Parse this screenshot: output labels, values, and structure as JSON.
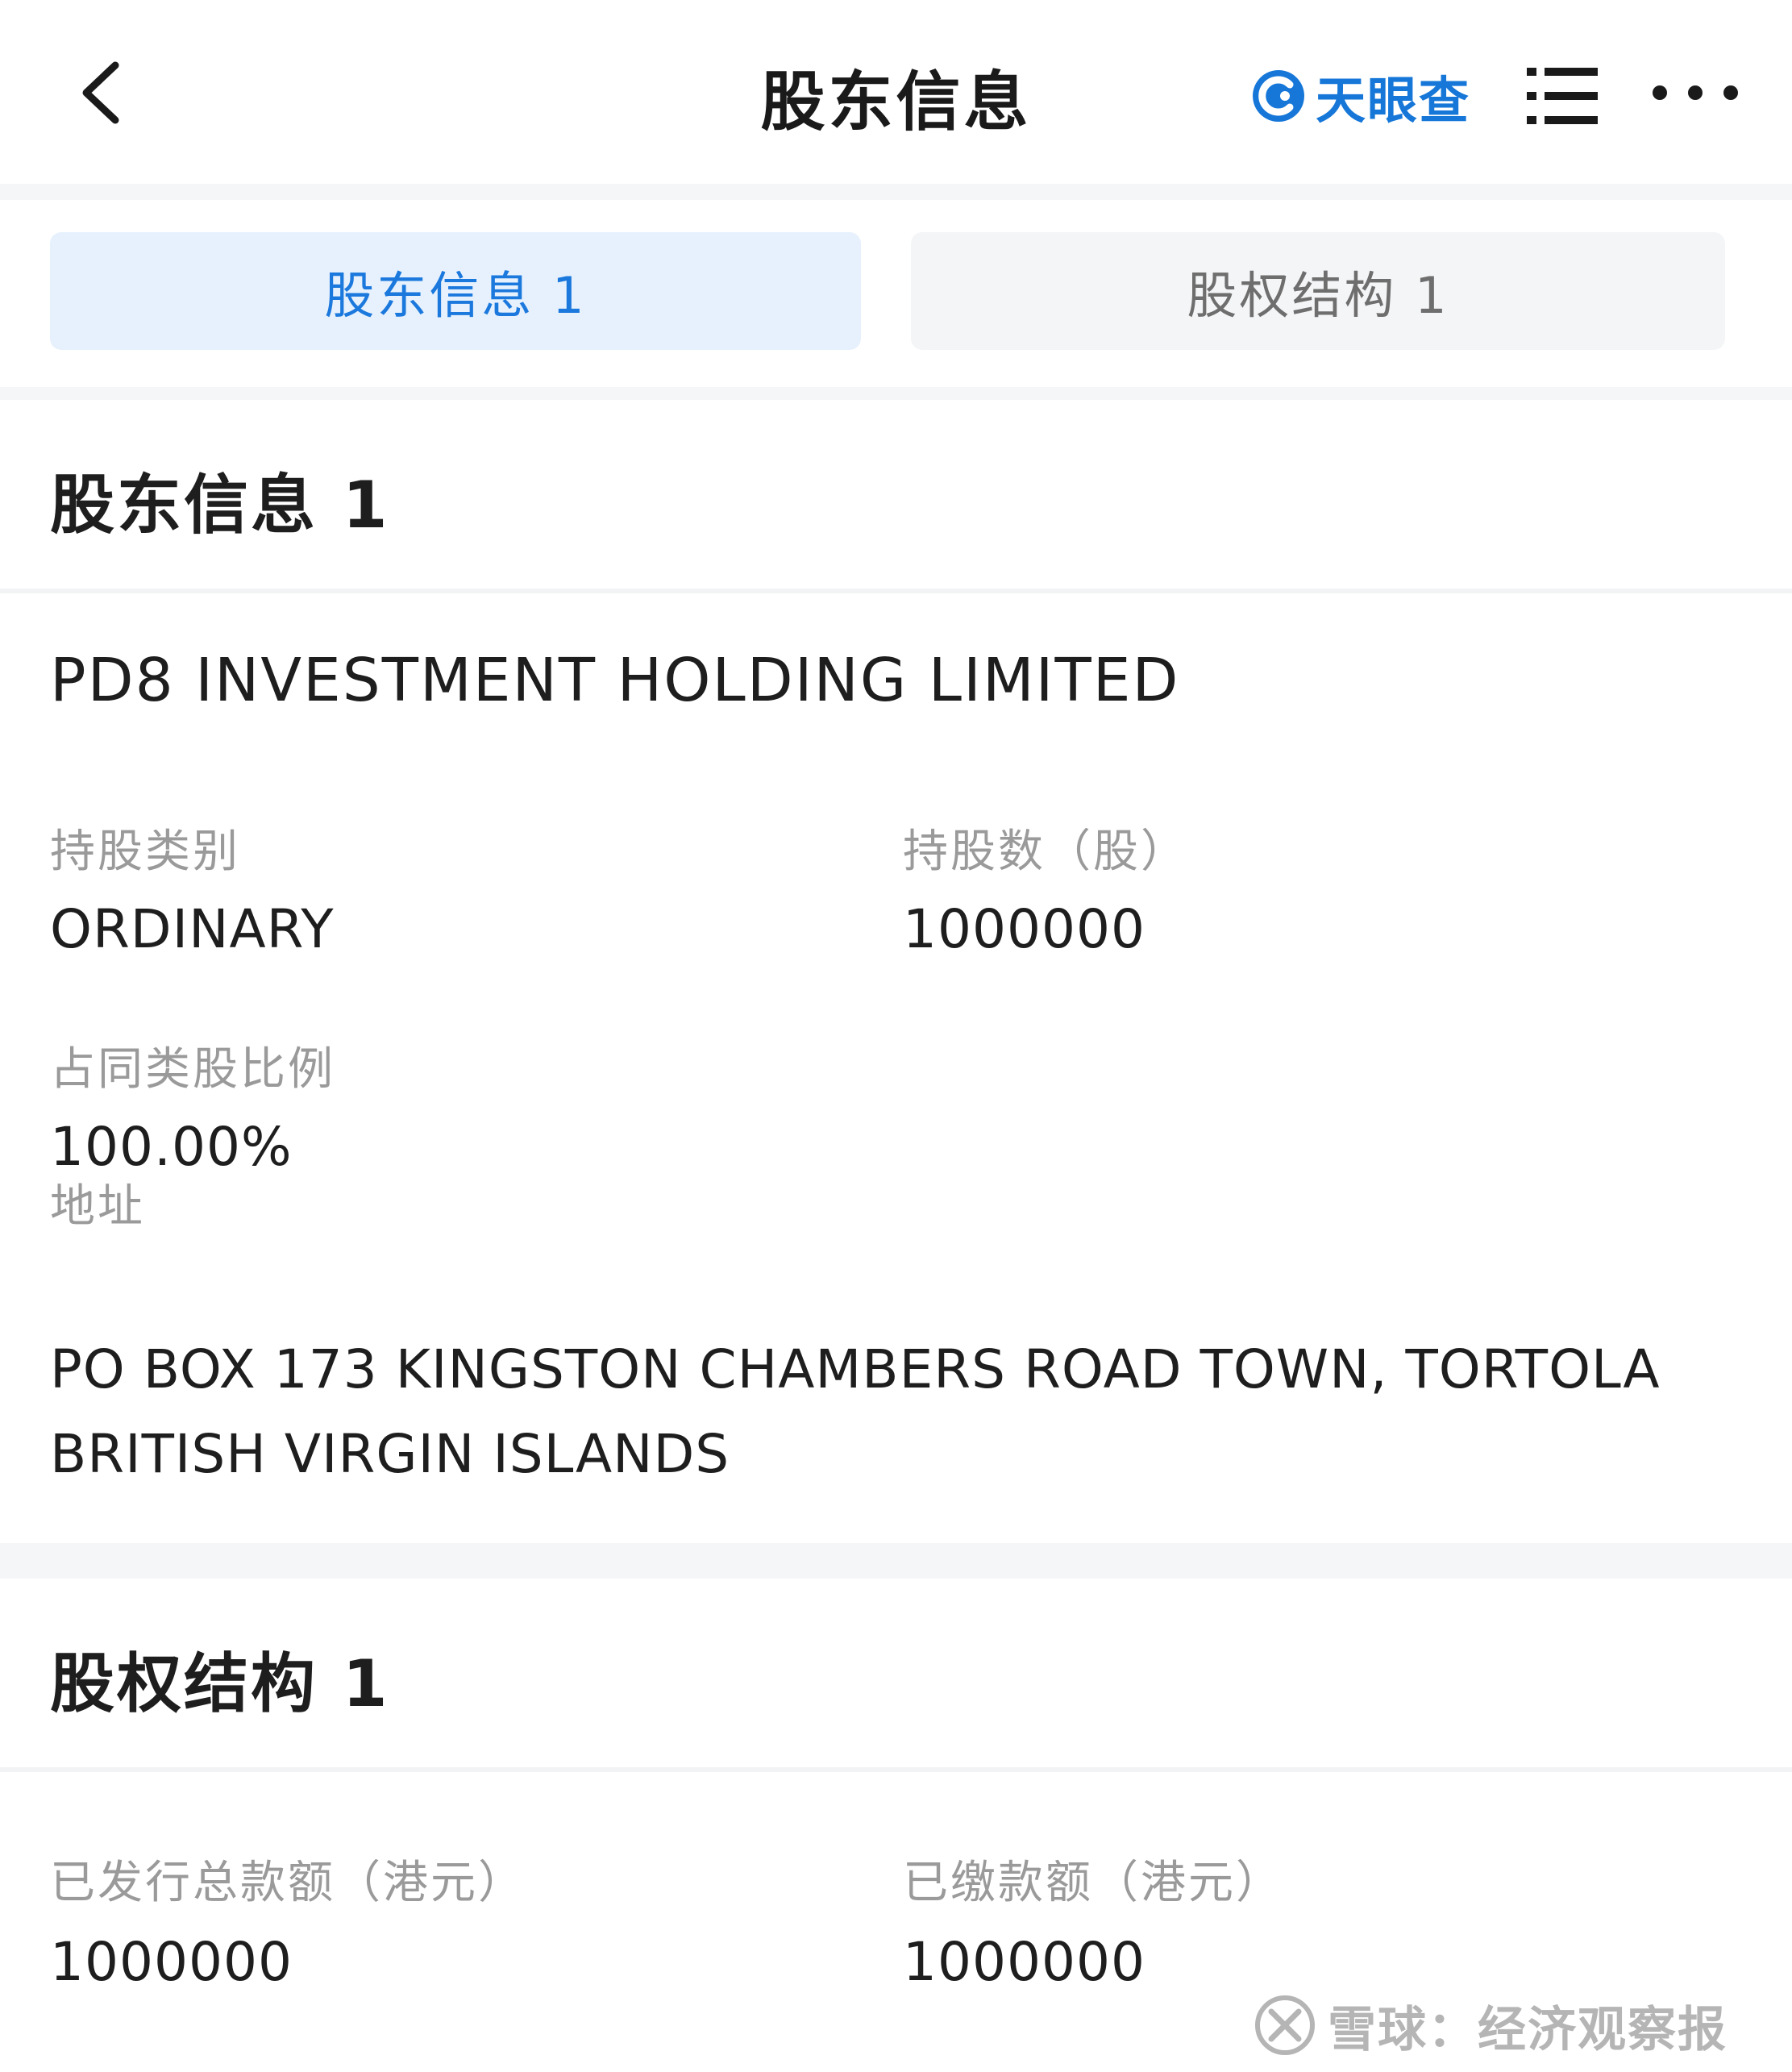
{
  "header": {
    "title": "股东信息",
    "brand_name": "天眼查",
    "icons": [
      "back-arrow-icon",
      "tianyancha-logo-icon",
      "list-menu-icon",
      "more-dots-icon"
    ]
  },
  "tabs": [
    {
      "label": "股东信息 1",
      "active": true
    },
    {
      "label": "股权结构 1",
      "active": false
    }
  ],
  "shareholders": {
    "title": "股东信息 1",
    "holder": {
      "name": "PD8 INVESTMENT HOLDING LIMITED",
      "share_class_label": "持股类别",
      "share_class": "ORDINARY",
      "share_count_label": "持股数（股）",
      "share_count": "1000000",
      "ratio_label": "占同类股比例",
      "ratio": "100.00%",
      "address_label": "地址",
      "address": "PO BOX 173 KINGSTON CHAMBERS ROAD TOWN, TORTOLA BRITISH VIRGIN ISLANDS"
    }
  },
  "equity": {
    "title": "股权结构 1",
    "issued_label": "已发行总款额（港元）",
    "issued_value": "1000000",
    "paid_label": "已缴款额（港元）",
    "paid_value": "1000000"
  },
  "watermark": {
    "text": "雪球：经济观察报"
  },
  "colors": {
    "accent": "#1b78dd",
    "tab_active_bg": "#e6f1fd",
    "label_gray": "#9a9a9a",
    "page_bg": "#f5f6f8"
  }
}
